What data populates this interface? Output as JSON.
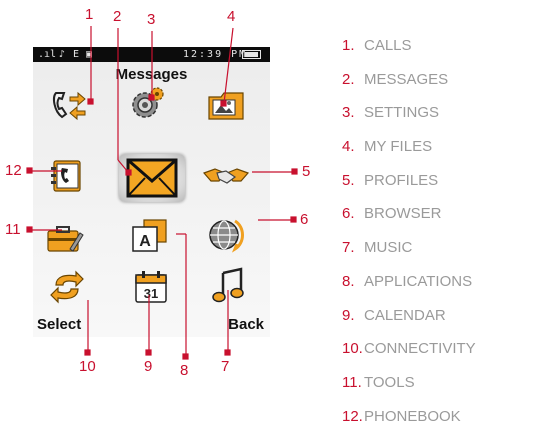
{
  "status_bar": {
    "network": "E",
    "time": "12:39 PM"
  },
  "screen_title": "Messages",
  "soft_keys": {
    "left": "Select",
    "right": "Back"
  },
  "icons": [
    {
      "num": "1",
      "name": "calls-icon"
    },
    {
      "num": "2",
      "name": "messages-icon"
    },
    {
      "num": "3",
      "name": "settings-icon"
    },
    {
      "num": "4",
      "name": "my-files-icon"
    },
    {
      "num": "5",
      "name": "profiles-icon"
    },
    {
      "num": "6",
      "name": "browser-icon"
    },
    {
      "num": "7",
      "name": "music-icon"
    },
    {
      "num": "8",
      "name": "applications-icon",
      "glyph": "A"
    },
    {
      "num": "9",
      "name": "calendar-icon",
      "glyph": "31"
    },
    {
      "num": "10",
      "name": "connectivity-icon"
    },
    {
      "num": "11",
      "name": "tools-icon"
    },
    {
      "num": "12",
      "name": "phonebook-icon"
    }
  ],
  "legend": [
    {
      "num": "1.",
      "label": "CALLS"
    },
    {
      "num": "2.",
      "label": "MESSAGES"
    },
    {
      "num": "3.",
      "label": "SETTINGS"
    },
    {
      "num": "4.",
      "label": "MY FILES"
    },
    {
      "num": "5.",
      "label": "PROFILES"
    },
    {
      "num": "6.",
      "label": "BROWSER"
    },
    {
      "num": "7.",
      "label": "MUSIC"
    },
    {
      "num": "8.",
      "label": "APPLICATIONS"
    },
    {
      "num": "9.",
      "label": "CALENDAR"
    },
    {
      "num": "10.",
      "label": "CONNECTIVITY"
    },
    {
      "num": "11.",
      "label": "TOOLS"
    },
    {
      "num": "12.",
      "label": "PHONEBOOK"
    }
  ],
  "colors": {
    "callout": "#c8102e",
    "legend_text": "#9a9a9a",
    "icon_orange": "#f0a020"
  }
}
